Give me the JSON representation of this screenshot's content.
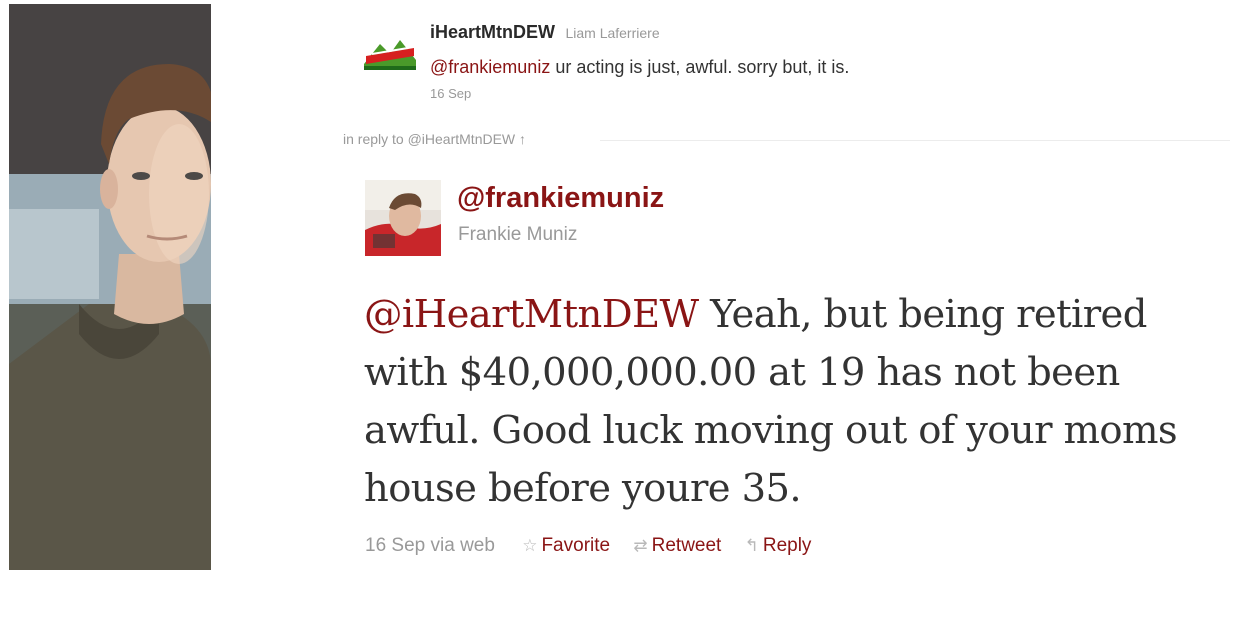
{
  "original_tweet": {
    "screen_name": "iHeartMtnDEW",
    "real_name": "Liam Laferriere",
    "mention": "@frankiemuniz",
    "text_rest": " ur acting is just, awful. sorry but, it is.",
    "date": "16 Sep",
    "avatar_icon": "mountain-dew-logo-avatar"
  },
  "in_reply_to": "in reply to @iHeartMtnDEW ↑",
  "main_tweet": {
    "handle": "@frankiemuniz",
    "name": "Frankie Muniz",
    "mention": "@iHeartMtnDEW",
    "text_rest": " Yeah, but being retired with $40,000,000.00 at 19 has not been awful. Good luck moving out of your moms house before youre 35.",
    "meta_time": "16 Sep via web",
    "actions": {
      "favorite": "Favorite",
      "retweet": "Retweet",
      "reply": "Reply"
    },
    "icons": {
      "favorite": "☆",
      "retweet": "⇄",
      "reply": "↰"
    }
  },
  "colors": {
    "link": "#8a1515",
    "muted": "#999999",
    "text": "#333333"
  }
}
